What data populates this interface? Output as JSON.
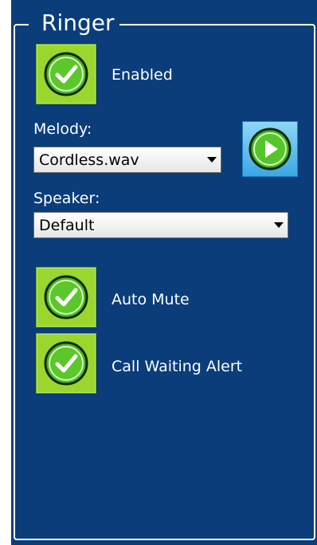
{
  "ringer": {
    "title": "Ringer",
    "enabled_label": "Enabled",
    "melody_label": "Melody:",
    "melody_value": "Cordless.wav",
    "speaker_label": "Speaker:",
    "speaker_value": "Default",
    "auto_mute_label": "Auto Mute",
    "call_waiting_label": "Call Waiting Alert"
  },
  "icons": {
    "checkbox": "check-icon",
    "play": "play-icon",
    "dropdown": "chevron-down-icon"
  },
  "colors": {
    "panel_bg": "#0a3d7a",
    "check_green": "#9bd62f",
    "play_blue": "#3aa8e3",
    "text": "#ffffff"
  }
}
